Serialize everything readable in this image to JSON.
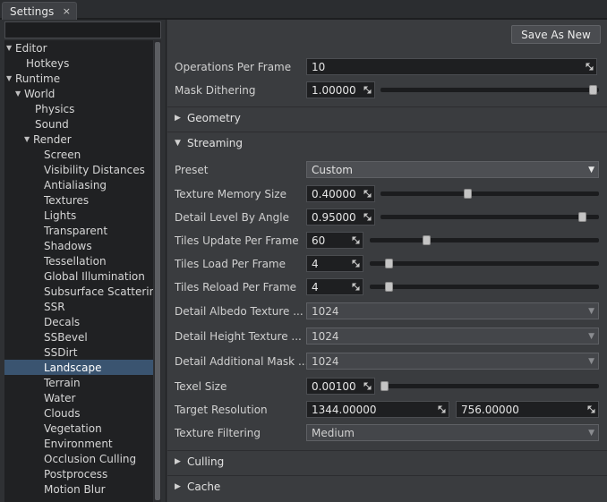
{
  "tab": {
    "title": "Settings",
    "close": "×"
  },
  "tree": {
    "items": [
      {
        "label": "Editor",
        "arrow": "▼",
        "indent": 0
      },
      {
        "label": "Hotkeys",
        "arrow": "",
        "indent": 1
      },
      {
        "label": "Runtime",
        "arrow": "▼",
        "indent": 0
      },
      {
        "label": "World",
        "arrow": "▼",
        "indent": 1
      },
      {
        "label": "Physics",
        "arrow": "",
        "indent": 2
      },
      {
        "label": "Sound",
        "arrow": "",
        "indent": 2
      },
      {
        "label": "Render",
        "arrow": "▼",
        "indent": 2
      },
      {
        "label": "Screen",
        "arrow": "",
        "indent": 3
      },
      {
        "label": "Visibility Distances",
        "arrow": "",
        "indent": 3
      },
      {
        "label": "Antialiasing",
        "arrow": "",
        "indent": 3
      },
      {
        "label": "Textures",
        "arrow": "",
        "indent": 3
      },
      {
        "label": "Lights",
        "arrow": "",
        "indent": 3
      },
      {
        "label": "Transparent",
        "arrow": "",
        "indent": 3
      },
      {
        "label": "Shadows",
        "arrow": "",
        "indent": 3
      },
      {
        "label": "Tessellation",
        "arrow": "",
        "indent": 3
      },
      {
        "label": "Global Illumination",
        "arrow": "",
        "indent": 3
      },
      {
        "label": "Subsurface Scattering",
        "arrow": "",
        "indent": 3
      },
      {
        "label": "SSR",
        "arrow": "",
        "indent": 3
      },
      {
        "label": "Decals",
        "arrow": "",
        "indent": 3
      },
      {
        "label": "SSBevel",
        "arrow": "",
        "indent": 3
      },
      {
        "label": "SSDirt",
        "arrow": "",
        "indent": 3
      },
      {
        "label": "Landscape",
        "arrow": "",
        "indent": 3,
        "selected": true
      },
      {
        "label": "Terrain",
        "arrow": "",
        "indent": 3
      },
      {
        "label": "Water",
        "arrow": "",
        "indent": 3
      },
      {
        "label": "Clouds",
        "arrow": "",
        "indent": 3
      },
      {
        "label": "Vegetation",
        "arrow": "",
        "indent": 3
      },
      {
        "label": "Environment",
        "arrow": "",
        "indent": 3
      },
      {
        "label": "Occlusion Culling",
        "arrow": "",
        "indent": 3
      },
      {
        "label": "Postprocess",
        "arrow": "",
        "indent": 3
      },
      {
        "label": "Motion Blur",
        "arrow": "",
        "indent": 3
      }
    ]
  },
  "toolbar": {
    "save_as_new": "Save As New"
  },
  "top": {
    "operations_label": "Operations Per Frame",
    "operations_value": "10",
    "mask_dithering_label": "Mask Dithering",
    "mask_dithering_value": "1.00000",
    "mask_dithering_level": 1.0
  },
  "sections": {
    "geometry": "Geometry",
    "streaming": "Streaming",
    "culling": "Culling",
    "cache": "Cache",
    "collapsed_arrow": "▶",
    "expanded_arrow": "▼"
  },
  "streaming": {
    "preset_label": "Preset",
    "preset_value": "Custom",
    "texture_memory_label": "Texture Memory Size",
    "texture_memory_value": "0.40000",
    "texture_memory_level": 0.4,
    "detail_angle_label": "Detail Level By Angle",
    "detail_angle_value": "0.95000",
    "detail_angle_level": 0.95,
    "tiles_update_label": "Tiles Update Per Frame",
    "tiles_update_value": "60",
    "tiles_update_level": 0.24,
    "tiles_load_label": "Tiles Load Per Frame",
    "tiles_load_value": "4",
    "tiles_load_level": 0.07,
    "tiles_reload_label": "Tiles Reload Per Frame",
    "tiles_reload_value": "4",
    "tiles_reload_level": 0.07,
    "albedo_label": "Detail Albedo Texture ...",
    "albedo_value": "1024",
    "height_label": "Detail Height Texture ...",
    "height_value": "1024",
    "mask_label": "Detail Additional Mask ...",
    "mask_value": "1024",
    "texel_label": "Texel Size",
    "texel_value": "0.00100",
    "texel_level": 0.0,
    "target_res_label": "Target Resolution",
    "target_res_x": "1344.00000",
    "target_res_y": "756.00000",
    "filtering_label": "Texture Filtering",
    "filtering_value": "Medium",
    "dropdown_arrow": "▼"
  }
}
